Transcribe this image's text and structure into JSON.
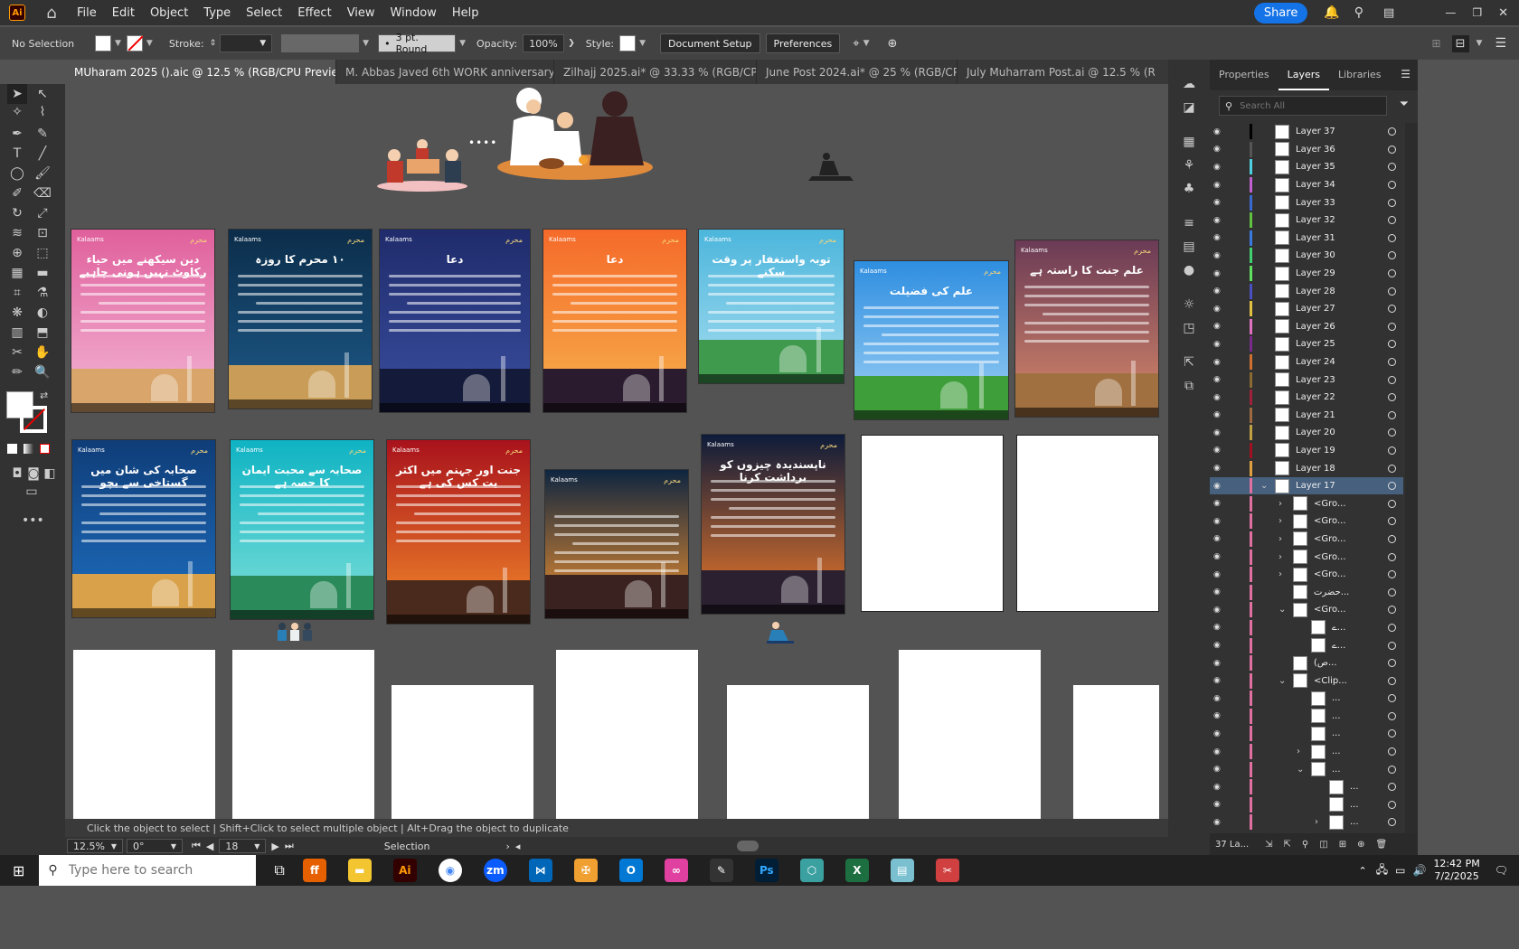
{
  "app": {
    "logo": "Ai",
    "home_icon": "home-icon"
  },
  "menu": [
    "File",
    "Edit",
    "Object",
    "Type",
    "Select",
    "Effect",
    "View",
    "Window",
    "Help"
  ],
  "topright": {
    "share": "Share"
  },
  "control": {
    "selection": "No Selection",
    "stroke_label": "Stroke:",
    "brush": "3 pt. Round",
    "opacity_label": "Opacity:",
    "opacity": "100%",
    "style_label": "Style:",
    "doc_setup": "Document Setup",
    "preferences": "Preferences"
  },
  "tabs": [
    {
      "label": "MUharam 2025 ().aic @ 12.5 % (RGB/CPU Preview)",
      "active": true
    },
    {
      "label": "M. Abbas Javed  6th  WORK anniversary.ai*"
    },
    {
      "label": "Zilhajj 2025.ai* @ 33.33 % (RGB/CPU ..."
    },
    {
      "label": "June Post 2024.ai* @ 25 % (RGB/CPU..."
    },
    {
      "label": "July Muharram Post.ai @ 12.5 % (RG..."
    }
  ],
  "artboards": {
    "logo": "Kalaams",
    "badge": "محرم",
    "row1": [
      {
        "title": "دین سیکھنے میں حیاء رکاوٹ نہیں ہونی چاہیے",
        "bg": [
          "#e0609c",
          "#f3b7d6"
        ],
        "ground": "#d9a56a"
      },
      {
        "title": "۱۰ محرم کا روزہ",
        "bg": [
          "#0c2d4a",
          "#1d5a8a"
        ],
        "ground": "#c99d57"
      },
      {
        "title": "دعا",
        "bg": [
          "#1f2b6b",
          "#3a4fa0"
        ],
        "ground": "#141a3a"
      },
      {
        "title": "دعا",
        "bg": [
          "#f56a2a",
          "#f7b14c"
        ],
        "ground": "#2a1c2e"
      },
      {
        "title": "توبہ واستغفار پر وقت سکنے",
        "bg": [
          "#4cb6dc",
          "#a4dcf0"
        ],
        "ground": "#3f9a4e"
      },
      {
        "title": "علم کی فضیلت",
        "bg": [
          "#2f8ee0",
          "#9dd1f5"
        ],
        "ground": "#3e9e3a"
      },
      {
        "title": "علم جنت کا راستہ ہے",
        "bg": [
          "#6a3a55",
          "#d98a6a"
        ],
        "ground": "#a07040"
      }
    ],
    "row2": [
      {
        "title": "صحابہ کی شان میں گستاخی سے بچو",
        "bg": [
          "#0f3d78",
          "#1e6ec0"
        ],
        "ground": "#d9a24a"
      },
      {
        "title": "صحابہ سے محبت ایمان کا حصہ ہے",
        "bg": [
          "#0fb3c4",
          "#7ee0d8"
        ],
        "ground": "#2a8a5a"
      },
      {
        "title": "جنت اور جہنم میں اکثر یت کس کی ہے",
        "bg": [
          "#a9121c",
          "#f38a2a"
        ],
        "ground": "#4a2a1c"
      },
      {
        "title": "",
        "bg": [
          "#0e2540",
          "#f3932f"
        ],
        "ground": "#3a2220"
      },
      {
        "title": "ناپسندیدہ چیزوں کو برداشت کرنا",
        "bg": [
          "#0d1b3a",
          "#f07a2a"
        ],
        "ground": "#2a2030"
      }
    ]
  },
  "status": {
    "hint": "Click the object to select  |  Shift+Click to select multiple object  |  Alt+Drag the object to duplicate",
    "zoom": "12.5%",
    "rotate": "0°",
    "page": "18",
    "tool": "Selection"
  },
  "panel": {
    "tabs": [
      "Properties",
      "Layers",
      "Libraries"
    ],
    "search_placeholder": "Search All",
    "count": "37 La..."
  },
  "layers": [
    {
      "name": "Layer 37",
      "color": "#000000"
    },
    {
      "name": "Layer 36",
      "color": "#555555"
    },
    {
      "name": "Layer 35",
      "color": "#4fd0e0"
    },
    {
      "name": "Layer 34",
      "color": "#c060d0"
    },
    {
      "name": "Layer 33",
      "color": "#3a6ad0"
    },
    {
      "name": "Layer 32",
      "color": "#60c040"
    },
    {
      "name": "Layer 31",
      "color": "#3a7ae0"
    },
    {
      "name": "Layer 30",
      "color": "#40d070"
    },
    {
      "name": "Layer 29",
      "color": "#60e060"
    },
    {
      "name": "Layer 28",
      "color": "#4a50c0"
    },
    {
      "name": "Layer 27",
      "color": "#e0c040"
    },
    {
      "name": "Layer 26",
      "color": "#e070c0"
    },
    {
      "name": "Layer 25",
      "color": "#7a2a8a"
    },
    {
      "name": "Layer 24",
      "color": "#d07030"
    },
    {
      "name": "Layer 23",
      "color": "#8a6a30"
    },
    {
      "name": "Layer 22",
      "color": "#a0203a"
    },
    {
      "name": "Layer 21",
      "color": "#a06a40"
    },
    {
      "name": "Layer 20",
      "color": "#c0a040"
    },
    {
      "name": "Layer 19",
      "color": "#a01020"
    },
    {
      "name": "Layer 18",
      "color": "#e0a040"
    },
    {
      "name": "Layer 17",
      "color": "#e070a0",
      "selected": true,
      "expanded": true
    },
    {
      "name": "<Gro...",
      "indent": 1,
      "collapsed": true
    },
    {
      "name": "<Gro...",
      "indent": 1,
      "collapsed": true
    },
    {
      "name": "<Gro...",
      "indent": 1,
      "collapsed": true
    },
    {
      "name": "<Gro...",
      "indent": 1,
      "collapsed": true
    },
    {
      "name": "<Gro...",
      "indent": 1,
      "collapsed": true
    },
    {
      "name": "حضرت...",
      "indent": 1
    },
    {
      "name": "<Gro...",
      "indent": 1,
      "expanded": true
    },
    {
      "name": "ے...",
      "indent": 2
    },
    {
      "name": "ے...",
      "indent": 2
    },
    {
      "name": "(ص...",
      "indent": 1
    },
    {
      "name": "<Clip...",
      "indent": 1,
      "expanded": true
    },
    {
      "name": "...",
      "indent": 2
    },
    {
      "name": "...",
      "indent": 2
    },
    {
      "name": "...",
      "indent": 2
    },
    {
      "name": "...",
      "indent": 2,
      "collapsed": true
    },
    {
      "name": "...",
      "indent": 2,
      "expanded": true
    },
    {
      "name": "...",
      "indent": 3
    },
    {
      "name": "...",
      "indent": 3
    },
    {
      "name": "...",
      "indent": 3,
      "collapsed": true
    }
  ],
  "taskbar": {
    "search_placeholder": "Type here to search",
    "time": "12:42 PM",
    "date": "7/2/2025",
    "apps": [
      {
        "label": "Ai",
        "color": "#330000",
        "fg": "#ff9a00"
      },
      {
        "label": "Ps",
        "color": "#001e36",
        "fg": "#31a8ff"
      },
      {
        "label": "X",
        "color": "#1d6f42",
        "fg": "#ffffff"
      }
    ]
  }
}
